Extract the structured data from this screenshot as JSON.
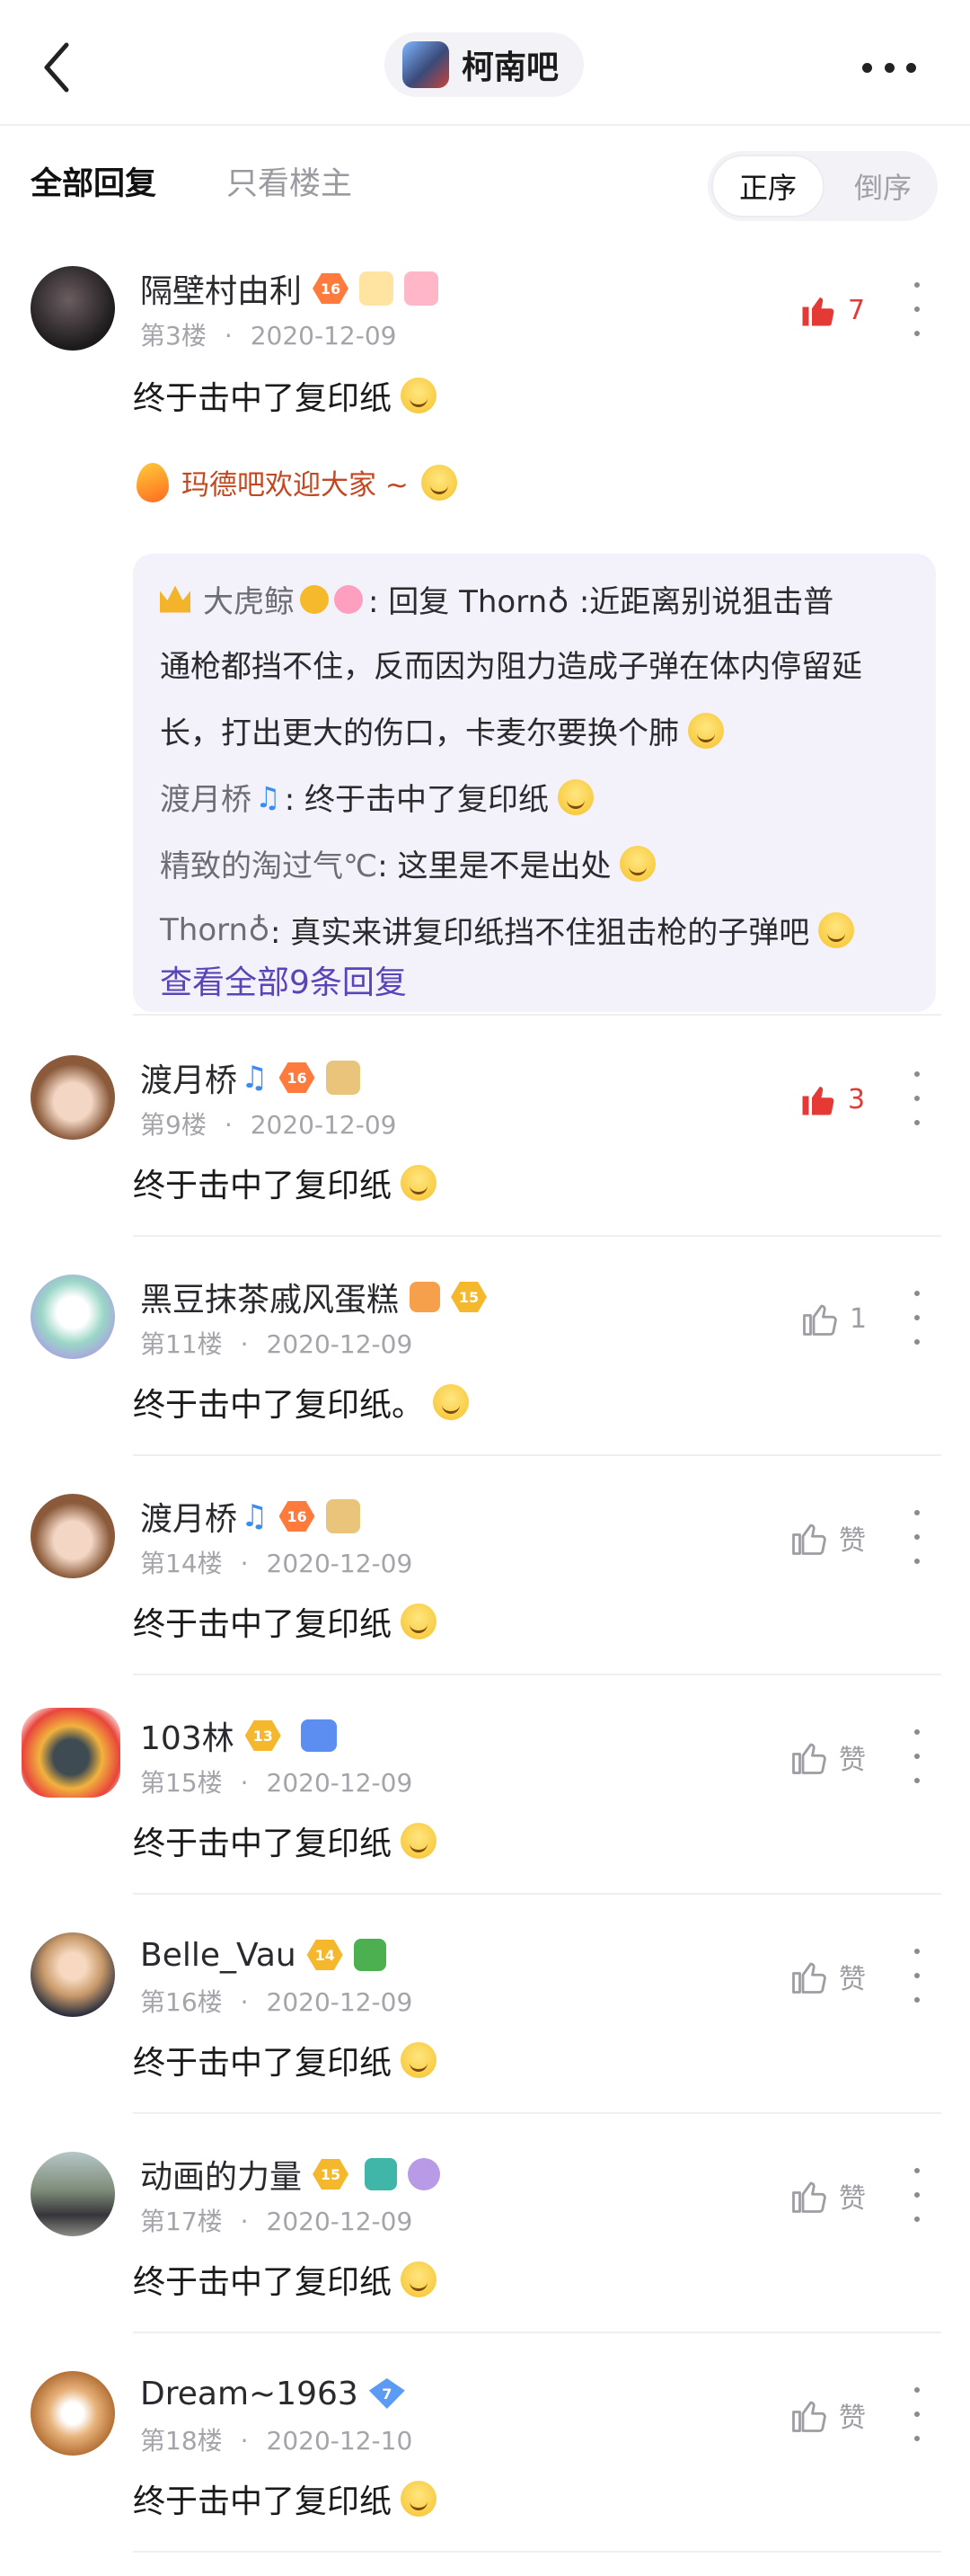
{
  "header": {
    "forum_name": "柯南吧",
    "back_icon": "chevron-left-icon",
    "more_icon": "more-horizontal-icon"
  },
  "filters": {
    "tab_all": "全部回复",
    "tab_op": "只看楼主",
    "sort_asc": "正序",
    "sort_desc": "倒序"
  },
  "comments": [
    {
      "name": "隔壁村由利",
      "level": "16",
      "floor": "第3楼",
      "date": "2020-12-09",
      "likes": "7",
      "text": "终于击中了复印纸",
      "signature": "玛德吧欢迎大家 ~",
      "replies": [
        {
          "name": "大虎鲸",
          "text": ": 回复 Thorn♁ :近距离别说狙击普"
        },
        {
          "name": "",
          "text": "通枪都挡不住，反而因为阻力造成子弹在体内停留延"
        },
        {
          "name": "",
          "text": "长，打出更大的伤口，卡麦尔要换个肺"
        },
        {
          "name": "渡月桥",
          "text": ": 终于击中了复印纸"
        },
        {
          "name": "精致的淘过气℃",
          "text": ": 这里是不是出处"
        },
        {
          "name": "Thorn♁",
          "text": ": 真实来讲复印纸挡不住狙击枪的子弹吧"
        }
      ],
      "see_all": "查看全部9条回复"
    },
    {
      "name": "渡月桥",
      "level": "16",
      "floor": "第9楼",
      "date": "2020-12-09",
      "likes": "3",
      "text": "终于击中了复印纸"
    },
    {
      "name": "黑豆抹茶戚风蛋糕",
      "level": "15",
      "floor": "第11楼",
      "date": "2020-12-09",
      "likes": "1",
      "text": "终于击中了复印纸。"
    },
    {
      "name": "渡月桥",
      "level": "16",
      "floor": "第14楼",
      "date": "2020-12-09",
      "likes": "赞",
      "text": "终于击中了复印纸"
    },
    {
      "name": "103林",
      "level": "13",
      "floor": "第15楼",
      "date": "2020-12-09",
      "likes": "赞",
      "text": "终于击中了复印纸"
    },
    {
      "name": "Belle_Vau",
      "level": "14",
      "floor": "第16楼",
      "date": "2020-12-09",
      "likes": "赞",
      "text": "终于击中了复印纸"
    },
    {
      "name": "动画的力量",
      "level": "15",
      "floor": "第17楼",
      "date": "2020-12-09",
      "likes": "赞",
      "text": "终于击中了复印纸"
    },
    {
      "name": "Dream~1963",
      "level": "7",
      "floor": "第18楼",
      "date": "2020-12-10",
      "likes": "赞",
      "text": "终于击中了复印纸"
    }
  ],
  "colors": {
    "like_active": "#e53935",
    "link_purple": "#5a44b8",
    "signature": "#c4471f"
  }
}
